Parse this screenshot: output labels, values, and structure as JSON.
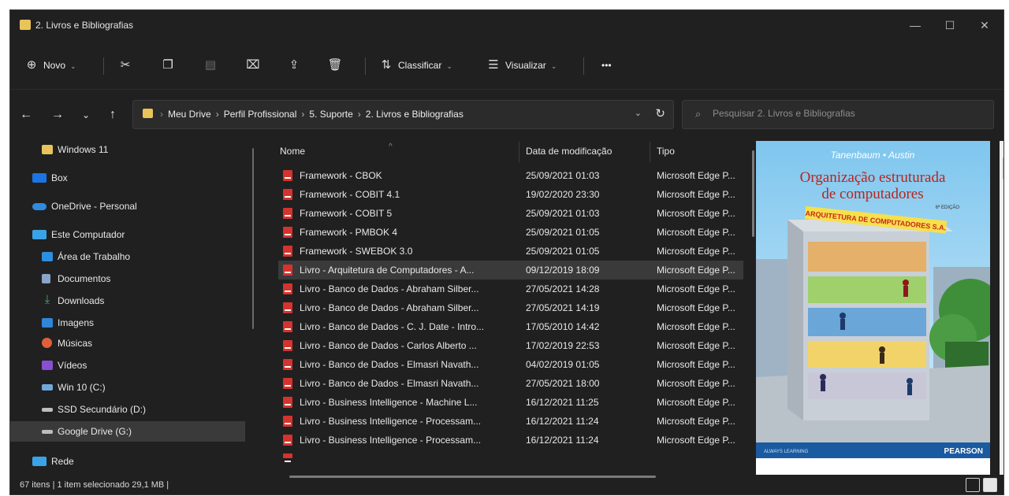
{
  "window": {
    "title": "2. Livros e Bibliografias",
    "min": "—",
    "max": "☐",
    "close": "✕"
  },
  "toolbar": {
    "new_label": "Novo",
    "sort_label": "Classificar",
    "view_label": "Visualizar",
    "more_label": "•••"
  },
  "address": {
    "crumbs": [
      "Meu Drive",
      "Perfil Profissional",
      "5. Suporte",
      "2. Livros e Bibliografias"
    ],
    "search_placeholder": "Pesquisar 2. Livros e Bibliografias"
  },
  "sidebar": {
    "items": [
      {
        "label": "Windows 11",
        "icon": "folder-icon",
        "color": "#e9c45a"
      },
      {
        "label": "Box",
        "icon": "box-icon",
        "color": "#1b74e4"
      },
      {
        "label": "OneDrive - Personal",
        "icon": "onedrive-icon",
        "color": "#2f8be0"
      },
      {
        "label": "Este Computador",
        "icon": "computer-icon",
        "color": "#3aa3e8"
      },
      {
        "label": "Área de Trabalho",
        "icon": "desktop-icon",
        "color": "#2c8fe0"
      },
      {
        "label": "Documentos",
        "icon": "documents-icon",
        "color": "#8aa4c8"
      },
      {
        "label": "Downloads",
        "icon": "downloads-icon",
        "color": "#3fb063"
      },
      {
        "label": "Imagens",
        "icon": "pictures-icon",
        "color": "#2f86d6"
      },
      {
        "label": "Músicas",
        "icon": "music-icon",
        "color": "#e0603a"
      },
      {
        "label": "Vídeos",
        "icon": "videos-icon",
        "color": "#8a4fd0"
      },
      {
        "label": "Win 10 (C:)",
        "icon": "drive-c-icon",
        "color": "#6fa9d9"
      },
      {
        "label": "SSD Secundário (D:)",
        "icon": "drive-icon",
        "color": "#bdbdbd"
      },
      {
        "label": "Google Drive (G:)",
        "icon": "drive-icon",
        "color": "#bdbdbd"
      },
      {
        "label": "Rede",
        "icon": "network-icon",
        "color": "#3aa3e8"
      }
    ]
  },
  "filelist": {
    "columns": {
      "name": "Nome",
      "date": "Data de modificação",
      "type": "Tipo"
    },
    "rows": [
      {
        "name": "Framework - CBOK",
        "date": "25/09/2021 01:03",
        "type": "Microsoft Edge P..."
      },
      {
        "name": "Framework - COBIT 4.1",
        "date": "19/02/2020 23:30",
        "type": "Microsoft Edge P..."
      },
      {
        "name": "Framework - COBIT 5",
        "date": "25/09/2021 01:03",
        "type": "Microsoft Edge P..."
      },
      {
        "name": "Framework - PMBOK 4",
        "date": "25/09/2021 01:05",
        "type": "Microsoft Edge P..."
      },
      {
        "name": "Framework - SWEBOK 3.0",
        "date": "25/09/2021 01:05",
        "type": "Microsoft Edge P..."
      },
      {
        "name": "Livro - Arquitetura de Computadores - A...",
        "date": "09/12/2019 18:09",
        "type": "Microsoft Edge P..."
      },
      {
        "name": "Livro - Banco de Dados - Abraham Silber...",
        "date": "27/05/2021 14:28",
        "type": "Microsoft Edge P..."
      },
      {
        "name": "Livro - Banco de Dados - Abraham Silber...",
        "date": "27/05/2021 14:19",
        "type": "Microsoft Edge P..."
      },
      {
        "name": "Livro - Banco de Dados - C. J. Date - Intro...",
        "date": "17/05/2010 14:42",
        "type": "Microsoft Edge P..."
      },
      {
        "name": "Livro - Banco de Dados - Carlos Alberto ...",
        "date": "17/02/2019 22:53",
        "type": "Microsoft Edge P..."
      },
      {
        "name": "Livro - Banco de Dados - Elmasri Navath...",
        "date": "04/02/2019 01:05",
        "type": "Microsoft Edge P..."
      },
      {
        "name": "Livro - Banco de Dados - Elmasri Navath...",
        "date": "27/05/2021 18:00",
        "type": "Microsoft Edge P..."
      },
      {
        "name": "Livro - Business Intelligence - Machine L...",
        "date": "16/12/2021 11:25",
        "type": "Microsoft Edge P..."
      },
      {
        "name": "Livro - Business Intelligence - Processam...",
        "date": "16/12/2021 11:24",
        "type": "Microsoft Edge P..."
      },
      {
        "name": "Livro - Business Intelligence - Processam...",
        "date": "16/12/2021 11:24",
        "type": "Microsoft Edge P..."
      }
    ]
  },
  "preview": {
    "authors": "Tanenbaum • Austin",
    "title_line1": "Organização estruturada",
    "title_line2": "de computadores",
    "edition": "6ª EDIÇÃO",
    "sign": "ARQUITETURA DE COMPUTADORES S.A.",
    "publisher": "PEARSON",
    "footer_left": "ALWAYS LEARNING"
  },
  "status": {
    "text": "67 itens  |  1 item selecionado  29,1 MB  |"
  },
  "colors": {
    "background": "#202020",
    "selection": "#3a3a3a",
    "pdf": "#d4332e",
    "accent": "#1b74e4"
  }
}
